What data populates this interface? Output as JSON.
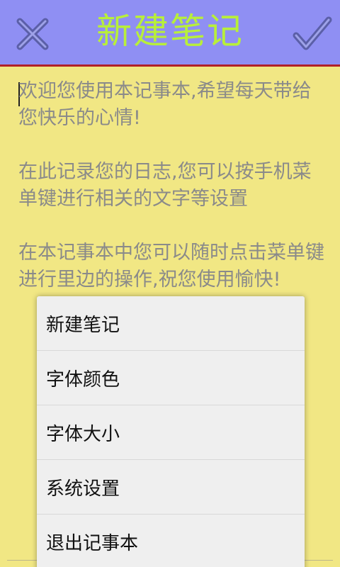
{
  "header": {
    "title": "新建笔记",
    "close_icon": "close-icon",
    "confirm_icon": "check-icon"
  },
  "note": {
    "paragraphs": [
      "欢迎您使用本记事本,希望每天带给您快乐的心情!",
      "在此记录您的日志,您可以按手机菜单键进行相关的文字等设置",
      "在本记事本中您可以随时点击菜单键进行里边的操作,祝您使用愉快!"
    ]
  },
  "menu": {
    "items": [
      {
        "label": "新建笔记"
      },
      {
        "label": "字体颜色"
      },
      {
        "label": "字体大小"
      },
      {
        "label": "系统设置"
      },
      {
        "label": "退出记事本"
      }
    ]
  },
  "colors": {
    "header_bg": "#8f8ff3",
    "title": "#b8ef3a",
    "note_bg": "#f1e784",
    "divider": "#b0202a",
    "menu_bg": "#efefef"
  }
}
